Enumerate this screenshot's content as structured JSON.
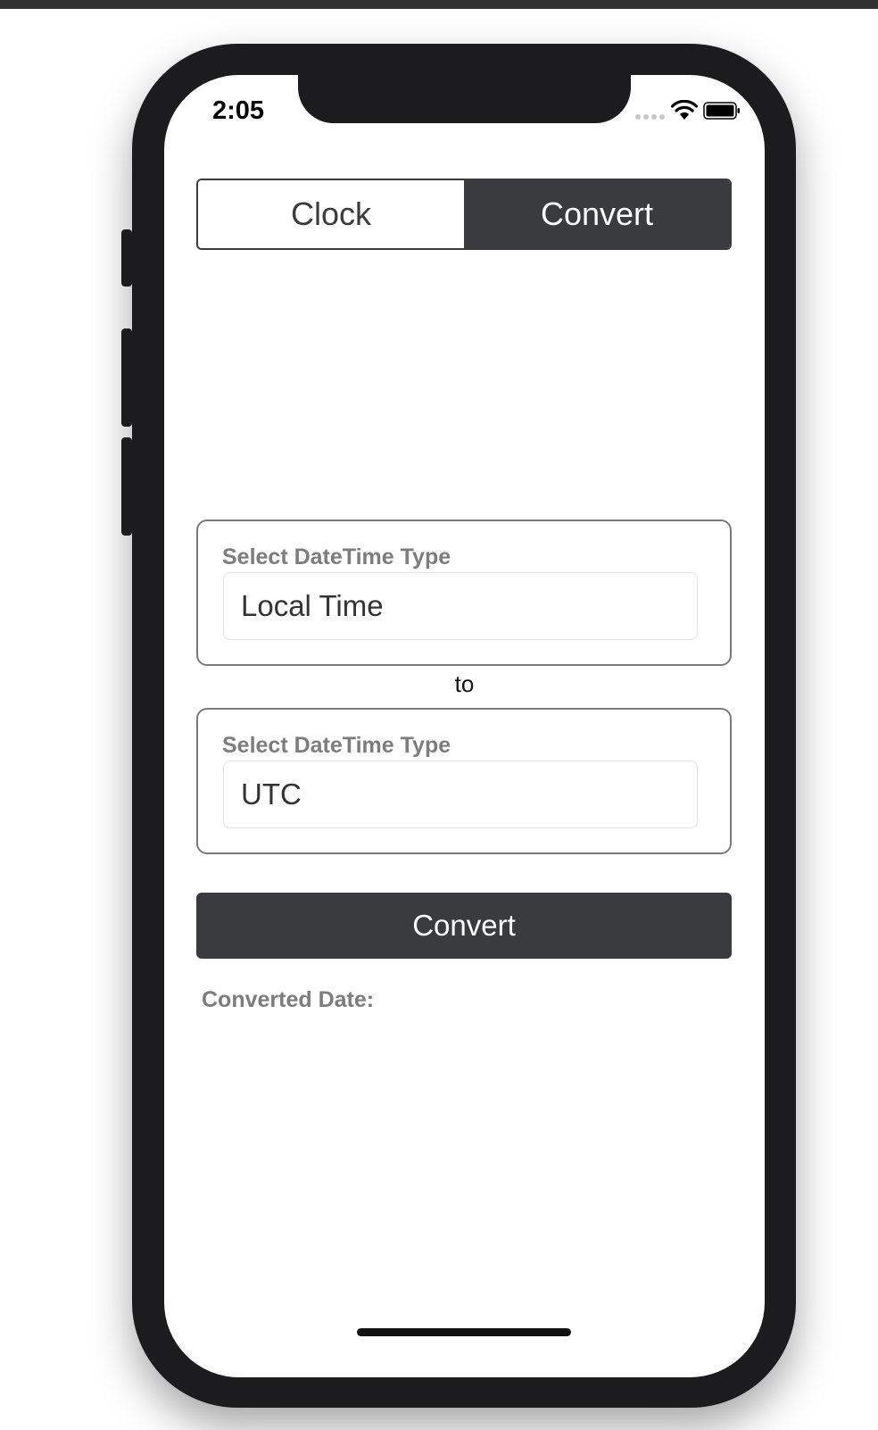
{
  "status_bar": {
    "time": "2:05"
  },
  "tabs": [
    {
      "label": "Clock",
      "active": false
    },
    {
      "label": "Convert",
      "active": true
    }
  ],
  "from_select": {
    "label": "Select DateTime Type",
    "value": "Local Time"
  },
  "connector": "to",
  "to_select": {
    "label": "Select DateTime Type",
    "value": "UTC"
  },
  "convert_button": {
    "label": "Convert"
  },
  "result": {
    "label": "Converted Date:",
    "value": ""
  },
  "colors": {
    "accent": "#3a3b3f",
    "label_gray": "#7d7d7d"
  }
}
